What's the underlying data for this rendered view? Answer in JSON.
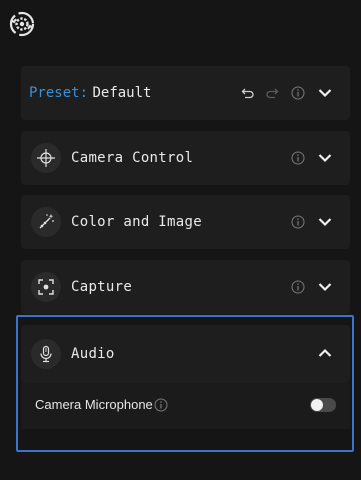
{
  "preset": {
    "prefix": "Preset:",
    "value": "Default"
  },
  "sections": [
    {
      "label": "Camera Control",
      "icon": "crosshair-icon",
      "expanded": false
    },
    {
      "label": "Color and Image",
      "icon": "magic-wand-icon",
      "expanded": false
    },
    {
      "label": "Capture",
      "icon": "capture-frame-icon",
      "expanded": false
    },
    {
      "label": "Audio",
      "icon": "microphone-icon",
      "expanded": true
    }
  ],
  "audio": {
    "camera_microphone_label": "Camera Microphone",
    "camera_microphone_enabled": false
  },
  "colors": {
    "accent_blue": "#3b8fd9",
    "focus_outline": "#3d72c9",
    "panel_bg": "#1e1e1e",
    "page_bg": "#151515"
  }
}
